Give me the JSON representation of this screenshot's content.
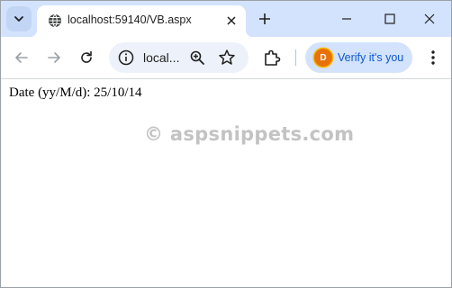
{
  "tab": {
    "title": "localhost:59140/VB.aspx",
    "favicon": "globe-icon",
    "close_icon": "close-icon"
  },
  "toolbar": {
    "address_text": "local...",
    "profile_initial": "D",
    "profile_label": "Verify it's you"
  },
  "page": {
    "date_line": "Date (yy/M/d): 25/10/14",
    "watermark": "© aspsnippets.com"
  },
  "colors": {
    "tabstrip": "#d3e3fd",
    "omnibox": "#edf2fa",
    "profile_chip": "#d3e3fd",
    "profile_text": "#0b57d0",
    "avatar": "#e8710a"
  }
}
